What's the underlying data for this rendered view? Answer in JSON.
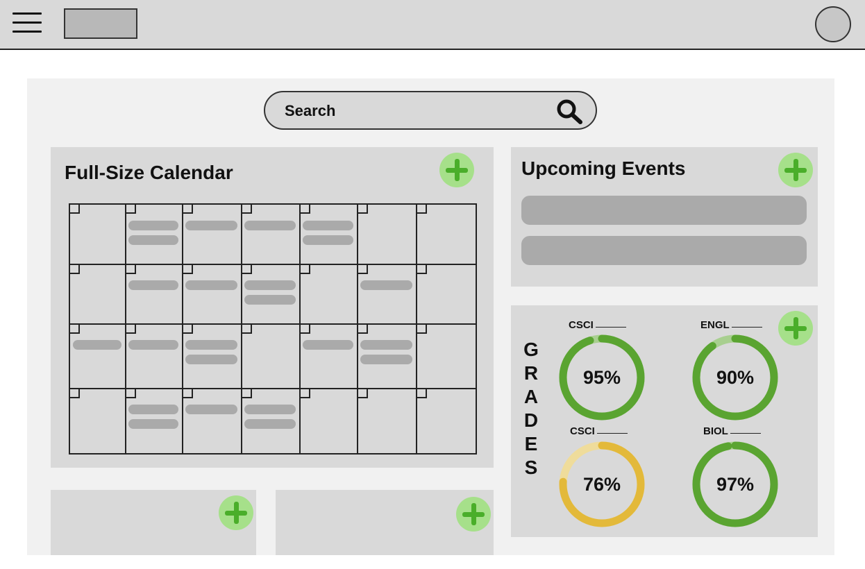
{
  "header": {
    "menu_icon": "hamburger-menu-icon",
    "logo_icon": "logo-placeholder",
    "avatar_icon": "user-avatar-icon"
  },
  "search": {
    "label": "Search",
    "icon": "search-icon"
  },
  "calendar": {
    "title": "Full-Size Calendar",
    "add_icon": "plus-icon",
    "rows": 4,
    "cols": 7,
    "events_per_day": [
      [
        0,
        2,
        1,
        1,
        2,
        0,
        0
      ],
      [
        0,
        1,
        1,
        2,
        0,
        1,
        0
      ],
      [
        1,
        1,
        2,
        0,
        1,
        2,
        0
      ],
      [
        0,
        2,
        1,
        2,
        0,
        0,
        0
      ]
    ]
  },
  "upcoming": {
    "title": "Upcoming Events",
    "add_icon": "plus-icon",
    "event_count": 2
  },
  "grades": {
    "vertical_label": [
      "G",
      "R",
      "A",
      "D",
      "E",
      "S"
    ],
    "add_icon": "plus-icon",
    "items": [
      {
        "course": "CSCI",
        "percent": "95%",
        "value": 0.95,
        "color": "#5aa431",
        "track": "#a8cf8f"
      },
      {
        "course": "ENGL",
        "percent": "90%",
        "value": 0.9,
        "color": "#5aa431",
        "track": "#a8cf8f"
      },
      {
        "course": "CSCI",
        "percent": "76%",
        "value": 0.76,
        "color": "#e3b93a",
        "track": "#efdc9b"
      },
      {
        "course": "BIOL",
        "percent": "97%",
        "value": 0.97,
        "color": "#5aa431",
        "track": "#a8cf8f"
      }
    ]
  },
  "widgets": [
    {
      "add_icon": "plus-icon"
    },
    {
      "add_icon": "plus-icon"
    }
  ],
  "colors": {
    "accent_green": "#4aae2a",
    "plus_bg": "#a6e08a",
    "panel": "#d9d9d9",
    "placeholder": "#aaaaaa"
  }
}
